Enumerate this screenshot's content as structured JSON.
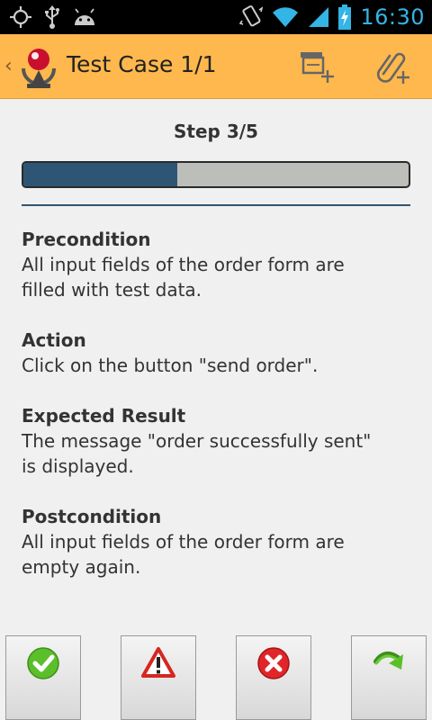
{
  "statusbar": {
    "time": "16:30",
    "icons": [
      "gps-icon",
      "usb-icon",
      "android-icon",
      "vibrate-icon",
      "wifi-icon",
      "signal-icon",
      "battery-charging-icon"
    ],
    "accent": "#33b5e5"
  },
  "actionbar": {
    "title": "Test Case 1/1",
    "background": "#ffb84d",
    "actions": [
      "add-note-icon",
      "add-attachment-icon"
    ]
  },
  "step": {
    "label": "Step 3/5",
    "progress_fraction": 0.4,
    "progress_color": "#2e5574"
  },
  "sections": [
    {
      "title": "Precondition",
      "text_lines": [
        "All input fields of the order form are",
        "filled with test data."
      ]
    },
    {
      "title": "Action",
      "text_lines": [
        "Click on the button \"send order\"."
      ]
    },
    {
      "title": "Expected Result",
      "text_lines": [
        "The message \"order successfully sent\"",
        "is displayed."
      ]
    },
    {
      "title": "Postcondition",
      "text_lines": [
        "All input fields of the order form are",
        "empty again."
      ]
    }
  ],
  "bottom_buttons": [
    "passed-check-icon",
    "warning-icon",
    "failed-x-icon",
    "skip-arrow-icon"
  ]
}
